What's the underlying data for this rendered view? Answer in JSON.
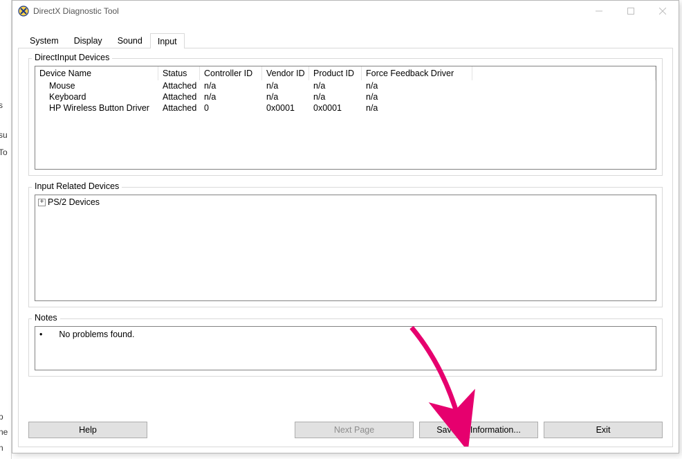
{
  "window": {
    "title": "DirectX Diagnostic Tool"
  },
  "tabs": [
    {
      "label": "System",
      "active": false
    },
    {
      "label": "Display",
      "active": false
    },
    {
      "label": "Sound",
      "active": false
    },
    {
      "label": "Input",
      "active": true
    }
  ],
  "groupboxes": {
    "direct": {
      "legend": "DirectInput Devices"
    },
    "related": {
      "legend": "Input Related Devices"
    },
    "notes": {
      "legend": "Notes"
    }
  },
  "directinput": {
    "columns": [
      "Device Name",
      "Status",
      "Controller ID",
      "Vendor ID",
      "Product ID",
      "Force Feedback Driver"
    ],
    "rows": [
      {
        "name": "Mouse",
        "status": "Attached",
        "controller": "n/a",
        "vendor": "n/a",
        "product": "n/a",
        "ff": "n/a"
      },
      {
        "name": "Keyboard",
        "status": "Attached",
        "controller": "n/a",
        "vendor": "n/a",
        "product": "n/a",
        "ff": "n/a"
      },
      {
        "name": "HP Wireless Button Driver",
        "status": "Attached",
        "controller": "0",
        "vendor": "0x0001",
        "product": "0x0001",
        "ff": "n/a"
      }
    ]
  },
  "related": {
    "root_label": "PS/2 Devices",
    "expand_glyph": "+"
  },
  "notes": {
    "line1": "No problems found."
  },
  "buttons": {
    "help": "Help",
    "next": "Next Page",
    "save": "Save All Information...",
    "exit": "Exit"
  },
  "left_strip": {
    "t1": "s",
    "t2": "su",
    "t3": "To",
    "t4": "p",
    "t5": "ne",
    "t6": "n"
  }
}
